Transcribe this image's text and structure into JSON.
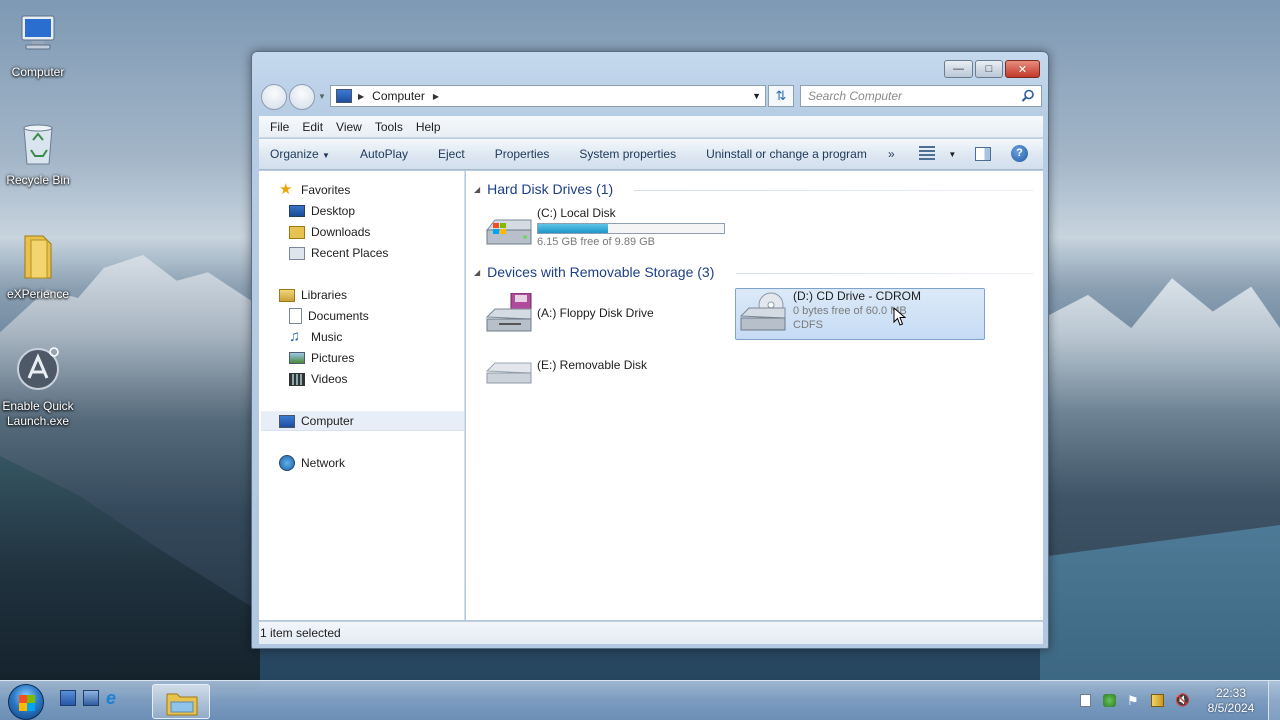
{
  "desktop": {
    "icons": [
      {
        "label": "Computer"
      },
      {
        "label": "Recycle Bin"
      },
      {
        "label": "eXPerience"
      },
      {
        "label": "Enable Quick Launch.exe"
      }
    ]
  },
  "window": {
    "address": {
      "crumb": "Computer"
    },
    "search_placeholder": "Search Computer",
    "menu": [
      "File",
      "Edit",
      "View",
      "Tools",
      "Help"
    ],
    "toolbar": {
      "organize": "Organize",
      "autoplay": "AutoPlay",
      "eject": "Eject",
      "properties": "Properties",
      "system_properties": "System properties",
      "uninstall": "Uninstall or change a program",
      "more": "»"
    },
    "nav": {
      "favorites": "Favorites",
      "desktop": "Desktop",
      "downloads": "Downloads",
      "recent": "Recent Places",
      "libraries": "Libraries",
      "documents": "Documents",
      "music": "Music",
      "pictures": "Pictures",
      "videos": "Videos",
      "computer": "Computer",
      "network": "Network"
    },
    "groups": {
      "hdd": "Hard Disk Drives (1)",
      "removable": "Devices with Removable Storage (3)"
    },
    "drives": {
      "c": {
        "name": "(C:) Local Disk",
        "free": "6.15 GB free of 9.89 GB",
        "used_fraction": 0.378
      },
      "a": {
        "name": "(A:) Floppy Disk Drive"
      },
      "d": {
        "name": "(D:) CD Drive - CDROM",
        "free": "0 bytes free of 60.0 MB",
        "fs": "CDFS"
      },
      "e": {
        "name": "(E:) Removable Disk"
      }
    },
    "status": "1 item selected"
  },
  "taskbar": {
    "time": "22:33",
    "date": "8/5/2024"
  }
}
